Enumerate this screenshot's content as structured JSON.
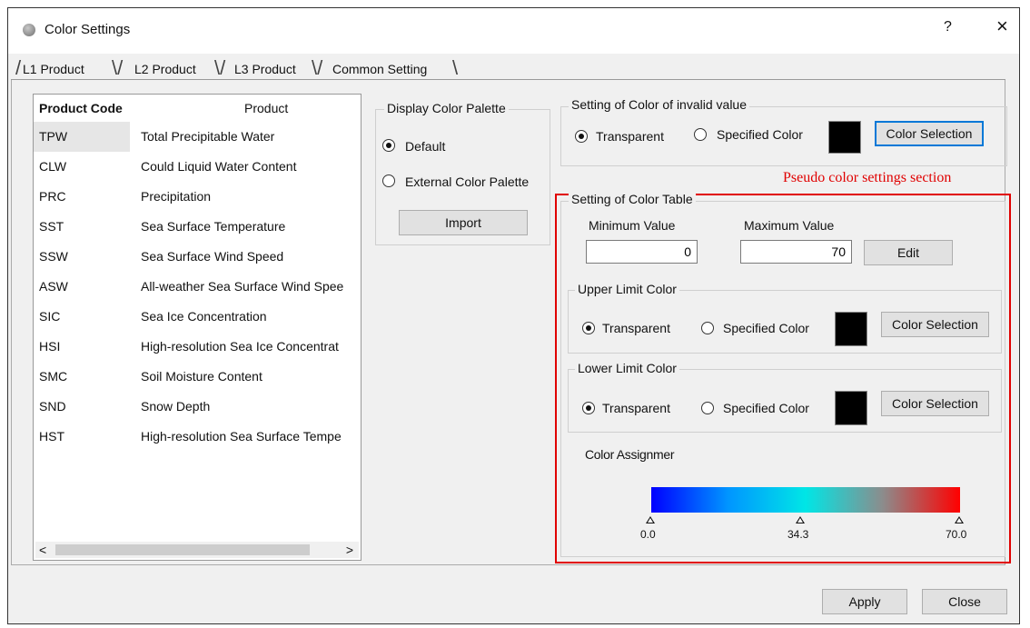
{
  "window": {
    "title": "Color Settings",
    "help": "?",
    "close": "×"
  },
  "tabs": [
    "L1 Product",
    "L2 Product",
    "L3 Product",
    "Common Setting"
  ],
  "product_list": {
    "columns": [
      "Product Code",
      "Product"
    ],
    "rows": [
      {
        "code": "TPW",
        "name": "Total Precipitable Water"
      },
      {
        "code": "CLW",
        "name": "Could Liquid Water Content"
      },
      {
        "code": "PRC",
        "name": "Precipitation"
      },
      {
        "code": "SST",
        "name": "Sea Surface Temperature"
      },
      {
        "code": "SSW",
        "name": "Sea Surface Wind Speed"
      },
      {
        "code": "ASW",
        "name": "All-weather Sea Surface Wind Spee"
      },
      {
        "code": "SIC",
        "name": "Sea Ice Concentration"
      },
      {
        "code": "HSI",
        "name": "High-resolution Sea Ice Concentrat"
      },
      {
        "code": "SMC",
        "name": "Soil Moisture Content"
      },
      {
        "code": "SND",
        "name": "Snow Depth"
      },
      {
        "code": "HST",
        "name": "High-resolution Sea Surface Tempe"
      }
    ],
    "selected_code": "TPW",
    "scroll_left": "<",
    "scroll_right": ">"
  },
  "display_palette": {
    "title": "Display Color Palette",
    "option_default": "Default",
    "option_external": "External Color Palette",
    "selected": "default",
    "import_label": "Import"
  },
  "invalid_color": {
    "title": "Setting of Color of invalid value",
    "transparent": "Transparent",
    "specified": "Specified Color",
    "selection_button": "Color Selection",
    "selected": "transparent",
    "swatch_color": "#000000"
  },
  "annotation": "Pseudo color settings section",
  "color_table": {
    "title": "Setting of Color Table",
    "min_label": "Minimum Value",
    "max_label": "Maximum Value",
    "min_value": "0",
    "max_value": "70",
    "edit_label": "Edit"
  },
  "upper_limit": {
    "title": "Upper Limit Color",
    "transparent": "Transparent",
    "specified": "Specified Color",
    "selection_button": "Color Selection",
    "selected": "transparent",
    "swatch_color": "#000000"
  },
  "lower_limit": {
    "title": "Lower Limit Color",
    "transparent": "Transparent",
    "specified": "Specified Color",
    "selection_button": "Color Selection",
    "selected": "transparent",
    "swatch_color": "#000000"
  },
  "color_assignment": {
    "label": "Color Assignmer",
    "gradient_colors": [
      "#0000ff",
      "#0096ff",
      "#00e6e6",
      "#8c8c8c",
      "#ff0000"
    ],
    "ticks": [
      "0.0",
      "34.3",
      "70.0"
    ]
  },
  "footer": {
    "apply": "Apply",
    "close": "Close"
  }
}
